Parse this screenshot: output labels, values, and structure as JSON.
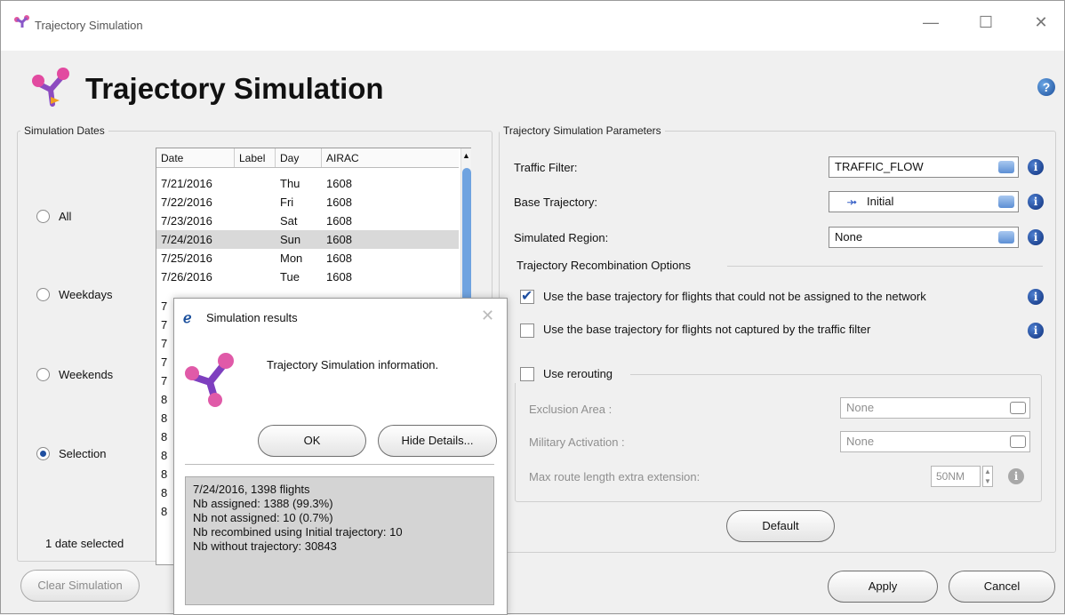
{
  "window": {
    "title": "Trajectory Simulation",
    "controls": {
      "minimize": "—",
      "maximize": "☐",
      "close": "✕"
    }
  },
  "header": {
    "title": "Trajectory Simulation",
    "help_icon": "?"
  },
  "dates_panel": {
    "legend": "Simulation Dates",
    "radios": [
      {
        "label": "All",
        "selected": false
      },
      {
        "label": "Weekdays",
        "selected": false
      },
      {
        "label": "Weekends",
        "selected": false
      },
      {
        "label": "Selection",
        "selected": true
      }
    ],
    "columns": [
      "Date",
      "Label",
      "Day",
      "AIRAC"
    ],
    "rows": [
      {
        "date": "7/21/2016",
        "label": "",
        "day": "Thu",
        "airac": "1608"
      },
      {
        "date": "7/22/2016",
        "label": "",
        "day": "Fri",
        "airac": "1608"
      },
      {
        "date": "7/23/2016",
        "label": "",
        "day": "Sat",
        "airac": "1608"
      },
      {
        "date": "7/24/2016",
        "label": "",
        "day": "Sun",
        "airac": "1608",
        "selected": true
      },
      {
        "date": "7/25/2016",
        "label": "",
        "day": "Mon",
        "airac": "1608"
      },
      {
        "date": "7/26/2016",
        "label": "",
        "day": "Tue",
        "airac": "1608"
      }
    ],
    "hidden_rows_prefix": [
      "7",
      "7",
      "7",
      "7",
      "7",
      "8",
      "8",
      "8",
      "8",
      "8",
      "8",
      "8"
    ],
    "status": "1 date selected"
  },
  "params": {
    "legend": "Trajectory Simulation Parameters",
    "traffic_filter": {
      "label": "Traffic Filter:",
      "value": "TRAFFIC_FLOW"
    },
    "base_trajectory": {
      "label": "Base Trajectory:",
      "value": "Initial"
    },
    "simulated_region": {
      "label": "Simulated Region:",
      "value": "None"
    },
    "recombination": {
      "title": "Trajectory Recombination Options",
      "opt1": {
        "label": "Use the base trajectory for flights that could not be assigned to the network",
        "checked": true
      },
      "opt2": {
        "label": "Use the base trajectory for flights not captured by the traffic filter",
        "checked": false
      }
    },
    "rerouting": {
      "label": "Use rerouting",
      "checked": false,
      "exclusion_area": {
        "label": "Exclusion Area :",
        "value": "None"
      },
      "military_activation": {
        "label": "Military Activation :",
        "value": "None"
      },
      "max_route": {
        "label": "Max route length extra extension:",
        "value": "50NM"
      }
    },
    "default_button": "Default"
  },
  "footer": {
    "clear_button": "Clear Simulation",
    "apply_button": "Apply",
    "cancel_button": "Cancel"
  },
  "dialog": {
    "title": "Simulation results",
    "message": "Trajectory Simulation information.",
    "ok_button": "OK",
    "hide_details_button": "Hide Details...",
    "details": [
      "7/24/2016, 1398 flights",
      "Nb assigned: 1388 (99.3%)",
      "Nb not assigned: 10 (0.7%)",
      "Nb recombined using Initial trajectory: 10",
      "Nb without trajectory: 30843"
    ]
  }
}
